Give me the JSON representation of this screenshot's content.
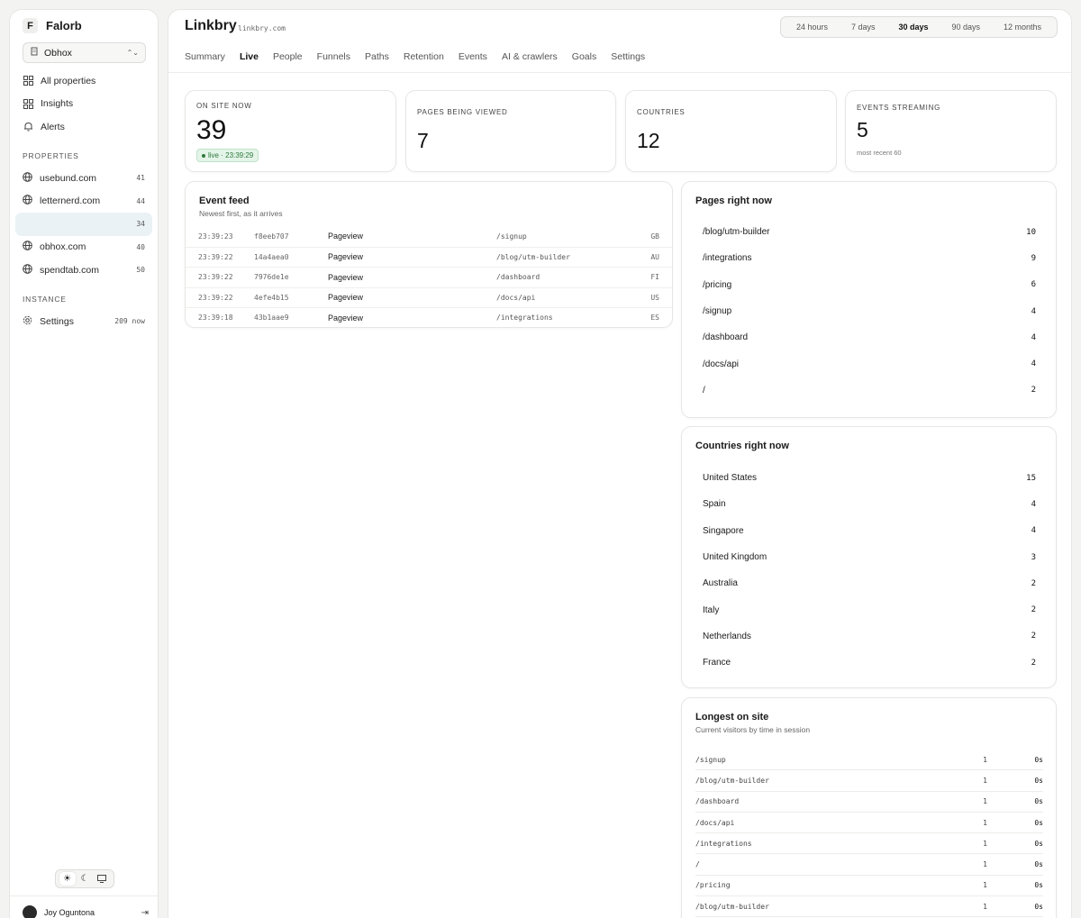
{
  "sidebar": {
    "brand_initial": "F",
    "brand_name": "Falorb",
    "org": "Obhox",
    "nav": [
      {
        "label": "All properties",
        "icon": "grid-icon"
      },
      {
        "label": "Insights",
        "icon": "grid-icon"
      },
      {
        "label": "Alerts",
        "icon": "bell-icon"
      }
    ],
    "properties_label": "PROPERTIES",
    "properties": [
      {
        "name": "usebund.com",
        "count": "41"
      },
      {
        "name": "letternerd.com",
        "count": "44"
      },
      {
        "name": "",
        "count": "34"
      },
      {
        "name": "obhox.com",
        "count": "40"
      },
      {
        "name": "spendtab.com",
        "count": "50"
      }
    ],
    "instance_label": "INSTANCE",
    "settings_label": "Settings",
    "settings_count": "209 now",
    "user_name": "Joy Oguntona"
  },
  "header": {
    "title": "Linkbry",
    "domain": "linkbry.com",
    "ranges": [
      "24 hours",
      "7 days",
      "30 days",
      "90 days",
      "12 months"
    ],
    "active_range": "30 days",
    "tabs": [
      "Summary",
      "Live",
      "People",
      "Funnels",
      "Paths",
      "Retention",
      "Events",
      "AI & crawlers",
      "Goals",
      "Settings"
    ],
    "active_tab": "Live"
  },
  "stats": {
    "on_site_label": "ON SITE NOW",
    "on_site_value": "39",
    "live_badge": "live · 23:39:29",
    "pages_label": "PAGES BEING VIEWED",
    "pages_value": "7",
    "countries_label": "COUNTRIES",
    "countries_value": "12",
    "events_label": "EVENTS STREAMING",
    "events_value": "5",
    "events_sub": "most recent 60"
  },
  "feed": {
    "title": "Event feed",
    "subtitle": "Newest first, as it arrives",
    "rows": [
      {
        "time": "23:39:23",
        "id": "f8eeb707",
        "type": "Pageview",
        "path": "/signup",
        "cc": "GB"
      },
      {
        "time": "23:39:22",
        "id": "14a4aea0",
        "type": "Pageview",
        "path": "/blog/utm-builder",
        "cc": "AU"
      },
      {
        "time": "23:39:22",
        "id": "7976de1e",
        "type": "Pageview",
        "path": "/dashboard",
        "cc": "FI"
      },
      {
        "time": "23:39:22",
        "id": "4efe4b15",
        "type": "Pageview",
        "path": "/docs/api",
        "cc": "US"
      },
      {
        "time": "23:39:18",
        "id": "43b1aae9",
        "type": "Pageview",
        "path": "/integrations",
        "cc": "ES"
      }
    ]
  },
  "pages_now": {
    "title": "Pages right now",
    "rows": [
      {
        "label": "/blog/utm-builder",
        "value": "10"
      },
      {
        "label": "/integrations",
        "value": "9"
      },
      {
        "label": "/pricing",
        "value": "6"
      },
      {
        "label": "/signup",
        "value": "4"
      },
      {
        "label": "/dashboard",
        "value": "4"
      },
      {
        "label": "/docs/api",
        "value": "4"
      },
      {
        "label": "/",
        "value": "2"
      }
    ]
  },
  "countries_now": {
    "title": "Countries right now",
    "rows": [
      {
        "label": "United States",
        "value": "15"
      },
      {
        "label": "Spain",
        "value": "4"
      },
      {
        "label": "Singapore",
        "value": "4"
      },
      {
        "label": "United Kingdom",
        "value": "3"
      },
      {
        "label": "Australia",
        "value": "2"
      },
      {
        "label": "Italy",
        "value": "2"
      },
      {
        "label": "Netherlands",
        "value": "2"
      },
      {
        "label": "France",
        "value": "2"
      }
    ]
  },
  "longest": {
    "title": "Longest on site",
    "subtitle": "Current visitors by time in session",
    "rows": [
      {
        "path": "/signup",
        "n": "1",
        "t": "0s"
      },
      {
        "path": "/blog/utm-builder",
        "n": "1",
        "t": "0s"
      },
      {
        "path": "/dashboard",
        "n": "1",
        "t": "0s"
      },
      {
        "path": "/docs/api",
        "n": "1",
        "t": "0s"
      },
      {
        "path": "/integrations",
        "n": "1",
        "t": "0s"
      },
      {
        "path": "/",
        "n": "1",
        "t": "0s"
      },
      {
        "path": "/pricing",
        "n": "1",
        "t": "0s"
      },
      {
        "path": "/blog/utm-builder",
        "n": "1",
        "t": "0s"
      }
    ]
  }
}
